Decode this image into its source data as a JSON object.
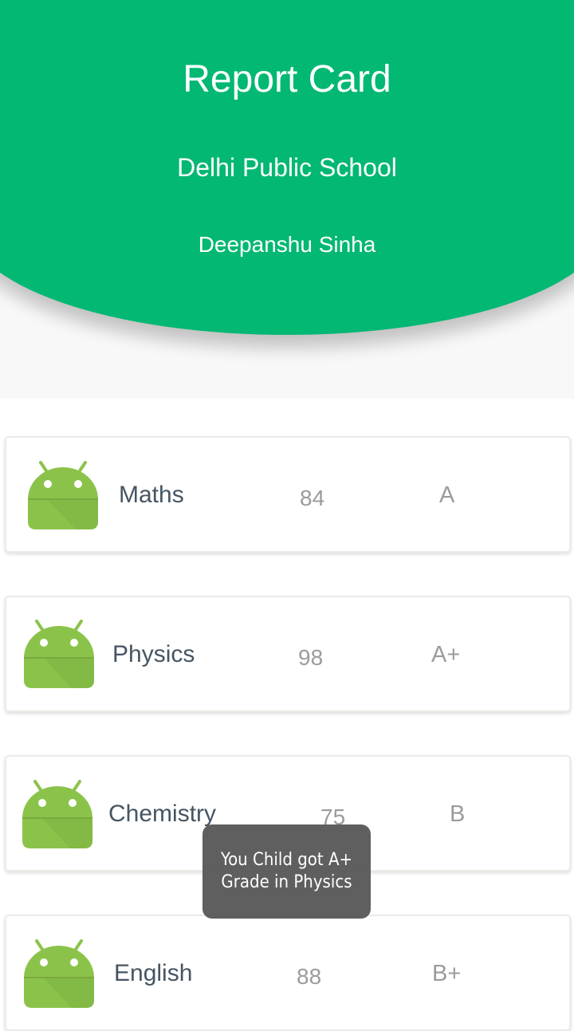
{
  "header": {
    "title": "Report Card",
    "school": "Delhi Public School",
    "student": "Deepanshu Sinha",
    "color": "#02b872"
  },
  "subjects": [
    {
      "name": "Maths",
      "marks": "84",
      "grade": "A",
      "icon": "android-icon"
    },
    {
      "name": "Physics",
      "marks": "98",
      "grade": "A+",
      "icon": "android-icon"
    },
    {
      "name": "Chemistry",
      "marks": "75",
      "grade": "B",
      "icon": "android-icon"
    },
    {
      "name": "English",
      "marks": "88",
      "grade": "B+",
      "icon": "android-icon"
    }
  ],
  "toast": {
    "message": "You Child got A+ Grade in Physics"
  }
}
